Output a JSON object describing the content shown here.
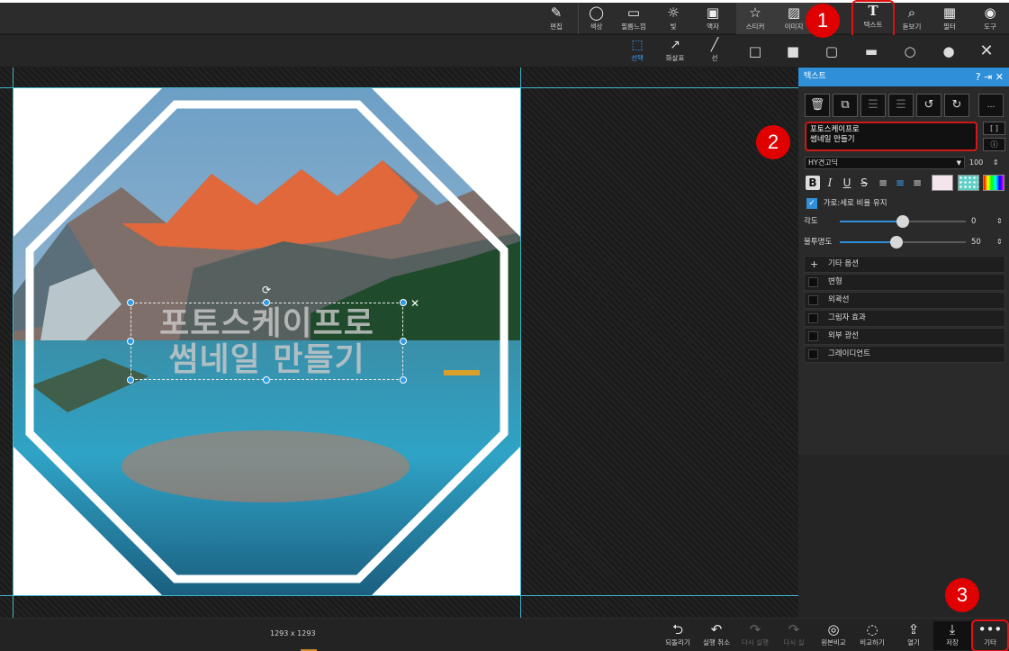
{
  "toolbar": {
    "items": [
      {
        "label": "편집",
        "icon": "edit-icon"
      },
      {
        "label": "색상",
        "icon": "color-icon"
      },
      {
        "label": "필름느낌",
        "icon": "film-icon"
      },
      {
        "label": "빛",
        "icon": "light-icon"
      },
      {
        "label": "액자",
        "icon": "frame-icon"
      },
      {
        "label": "스티커",
        "icon": "sticker-icon"
      },
      {
        "label": "이미지",
        "icon": "image-icon"
      },
      {
        "label": "텍스트",
        "icon": "text-icon"
      },
      {
        "label": "돋보기",
        "icon": "magnifier-icon"
      },
      {
        "label": "필터",
        "icon": "filter-icon"
      },
      {
        "label": "도구",
        "icon": "tools-icon"
      }
    ]
  },
  "subtoolbar": {
    "select_label": "선택",
    "arrow_label": "화살표",
    "line_label": "선"
  },
  "canvas": {
    "overlay_line1": "포토스케이프로",
    "overlay_line2": "썸네일 만들기"
  },
  "panel": {
    "title": "텍스트",
    "text_value": "포토스케이프로\n썸네일 만들기",
    "bracket_btn": "[ ]",
    "more_btn": "...",
    "font_name": "HY견고딕",
    "font_size": "100",
    "keep_ratio_label": "가로:세로 비율 유지",
    "angle_label": "각도",
    "angle_value": "0",
    "opacity_label": "불투명도",
    "opacity_value": "50",
    "more_options_label": "기타 옵션",
    "options": [
      "변형",
      "외곽선",
      "그림자 효과",
      "외부 광선",
      "그레이디언트"
    ]
  },
  "status": {
    "dimensions": "1293 x 1293",
    "buttons": [
      {
        "label": "되돌리기",
        "icon": "revert-icon"
      },
      {
        "label": "실행 취소",
        "icon": "undo-icon"
      },
      {
        "label": "다시 실행",
        "icon": "redo-icon"
      },
      {
        "label": "다시 실",
        "icon": "redo-all-icon"
      },
      {
        "label": "원본비교",
        "icon": "original-icon"
      },
      {
        "label": "비교하기",
        "icon": "compare-icon"
      },
      {
        "label": "열기",
        "icon": "open-icon"
      },
      {
        "label": "저장",
        "icon": "save-icon"
      },
      {
        "label": "기타",
        "icon": "more-icon"
      }
    ]
  },
  "callouts": [
    "1",
    "2",
    "3"
  ],
  "colors": {
    "accent": "#2f8fd8",
    "highlight": "#e01010",
    "guide": "#3fb6c8"
  }
}
